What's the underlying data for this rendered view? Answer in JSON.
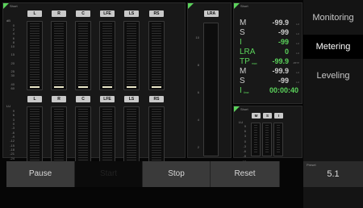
{
  "ref_tag": "Short",
  "meters_top": {
    "unit": "dB",
    "channels": [
      "L",
      "R",
      "C",
      "LFE",
      "LS",
      "RS"
    ],
    "scale": [
      "0",
      "2",
      "4",
      "6",
      "8",
      "10",
      "",
      "15",
      "",
      "20",
      "",
      "25",
      "30",
      "",
      "40",
      "60"
    ]
  },
  "meters_bottom": {
    "unit": "LU",
    "channels": [
      "L",
      "R",
      "C",
      "LFE",
      "LS",
      "RS"
    ],
    "scale": [
      "9",
      "6",
      "3",
      "0",
      "-3",
      "-6",
      "-9",
      "-12",
      "-15",
      "-18",
      "-21",
      "-24",
      "-30",
      "-36",
      "-42",
      "-48"
    ]
  },
  "lra_panel": {
    "label": "LRA",
    "scale": [
      "10",
      "8",
      "6",
      "4",
      "2"
    ]
  },
  "readout": {
    "rows": [
      {
        "label": "M",
        "value": "-99.9",
        "unit": "LU",
        "color": "#cfcfcf"
      },
      {
        "label": "S",
        "value": "-99",
        "unit": "LU",
        "color": "#cfcfcf"
      },
      {
        "label": "I",
        "value": "-99",
        "unit": "LU",
        "color": "#5bd35b"
      },
      {
        "label": "LRA",
        "value": "0",
        "unit": "LU",
        "color": "#5bd35b"
      },
      {
        "label": "TP",
        "sub": "max",
        "value": "-99.9",
        "unit": "dBTP",
        "color": "#5bd35b"
      },
      {
        "label": "M",
        "value": "-99.9",
        "unit": "LU",
        "color": "#cfcfcf"
      },
      {
        "label": "S",
        "value": "-99",
        "unit": "LU",
        "color": "#cfcfcf"
      },
      {
        "label": "I",
        "sub": "time",
        "value": "00:00:40",
        "unit": "",
        "color": "#5bd35b"
      }
    ]
  },
  "msi_panel": {
    "unit": "LU",
    "buttons": [
      "M",
      "S",
      "I"
    ],
    "scale": [
      "9",
      "6",
      "3",
      "0",
      "-3",
      "-6",
      "-9",
      "-12",
      "-15",
      "-18"
    ]
  },
  "sidebar": {
    "items": [
      {
        "label": "Monitoring",
        "active": false
      },
      {
        "label": "Metering",
        "active": true
      },
      {
        "label": "Leveling",
        "active": false
      }
    ]
  },
  "toolbar": {
    "pause": "Pause",
    "start": "Start",
    "stop": "Stop",
    "reset": "Reset"
  },
  "preset": {
    "label": "Preset",
    "value": "5.1"
  },
  "colors": {
    "accent_green": "#5bd35b",
    "active_bg": "#000000",
    "sidebar_bg": "#141414"
  }
}
